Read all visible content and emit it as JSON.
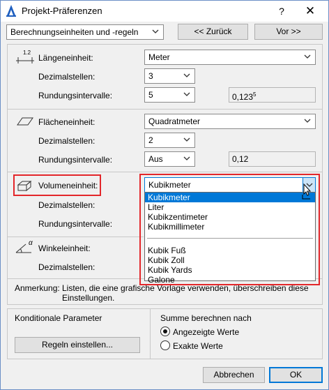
{
  "window": {
    "title": "Projekt-Präferenzen",
    "help_glyph": "?",
    "close_glyph": "✕"
  },
  "topbar": {
    "page_select": "Berechnungseinheiten und -regeln",
    "back_label": "<< Zurück",
    "next_label": "Vor >>"
  },
  "length": {
    "unit_label": "Längeneinheit:",
    "unit_value": "Meter",
    "decimals_label": "Dezimalstellen:",
    "decimals_value": "3",
    "rounding_label": "Rundungsintervalle:",
    "rounding_value": "5",
    "preview": "0,123",
    "preview_sup": "5",
    "icon_digits": "1.2"
  },
  "area": {
    "unit_label": "Flächeneinheit:",
    "unit_value": "Quadratmeter",
    "decimals_label": "Dezimalstellen:",
    "decimals_value": "2",
    "rounding_label": "Rundungsintervalle:",
    "rounding_value": "Aus",
    "preview": "0,12"
  },
  "volume": {
    "unit_label": "Volumeneinheit:",
    "unit_value": "Kubikmeter",
    "decimals_label": "Dezimalstellen:",
    "rounding_label": "Rundungsintervalle:",
    "options_group1": [
      "Kubikmeter",
      "Liter",
      "Kubikzentimeter",
      "Kubikmillimeter"
    ],
    "options_group2": [
      "Kubik Fuß",
      "Kubik Zoll",
      "Kubik Yards",
      "Galone"
    ],
    "selected_option": "Kubikmeter"
  },
  "angle": {
    "unit_label": "Winkeleinheit:",
    "decimals_label": "Dezimalstellen:",
    "icon_glyph": "α"
  },
  "note": {
    "label": "Anmerkung:",
    "text_line1": "Listen, die eine grafische Vorlage verwenden, überschreiben diese",
    "text_line2": "Einstellungen."
  },
  "conditional": {
    "title": "Konditionale Parameter",
    "rules_button": "Regeln einstellen..."
  },
  "sum": {
    "title": "Summe berechnen nach",
    "option_shown": "Angezeigte Werte",
    "option_exact": "Exakte Werte",
    "selected": "Angezeigte Werte"
  },
  "footer": {
    "cancel_label": "Abbrechen",
    "ok_label": "OK"
  },
  "colors": {
    "highlight": "#e3262a",
    "selection": "#0078d7",
    "app_icon": "#1f5fbf"
  }
}
